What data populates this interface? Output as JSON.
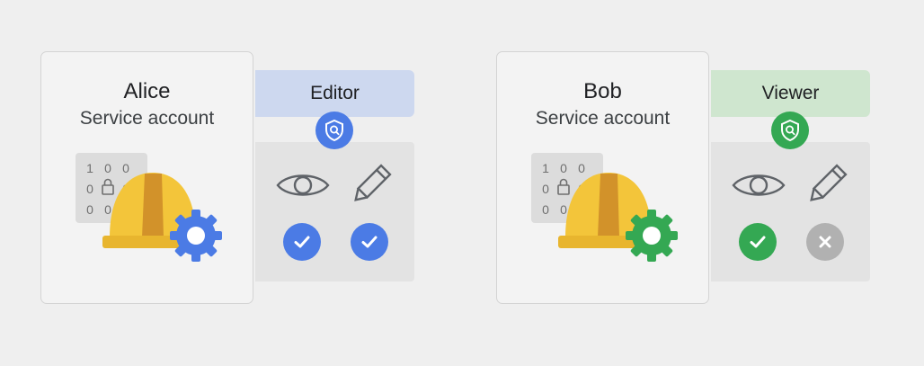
{
  "colors": {
    "editor_tag": "#cdd8ef",
    "viewer_tag": "#cfe6cf",
    "google_blue": "#4b7be5",
    "google_green": "#34a853",
    "deny_grey": "#b1b1b1",
    "hat_yellow": "#f3c53a",
    "hat_stripe": "#d2922a"
  },
  "accounts": [
    {
      "name": "Alice",
      "subtitle": "Service account",
      "role": "Editor",
      "gear_color": "#4b7be5",
      "permissions": {
        "view": {
          "icon": "eye-icon",
          "granted": true,
          "status_icon": "check-icon",
          "color": "#4b7be5"
        },
        "edit": {
          "icon": "pencil-icon",
          "granted": true,
          "status_icon": "check-icon",
          "color": "#4b7be5"
        }
      }
    },
    {
      "name": "Bob",
      "subtitle": "Service account",
      "role": "Viewer",
      "gear_color": "#34a853",
      "permissions": {
        "view": {
          "icon": "eye-icon",
          "granted": true,
          "status_icon": "check-icon",
          "color": "#34a853"
        },
        "edit": {
          "icon": "pencil-icon",
          "granted": false,
          "status_icon": "x-icon",
          "color": "#b1b1b1"
        }
      }
    }
  ],
  "binary_grid": [
    "1",
    "0",
    "0",
    "0",
    "lock",
    "0",
    "0",
    "0",
    "0"
  ]
}
